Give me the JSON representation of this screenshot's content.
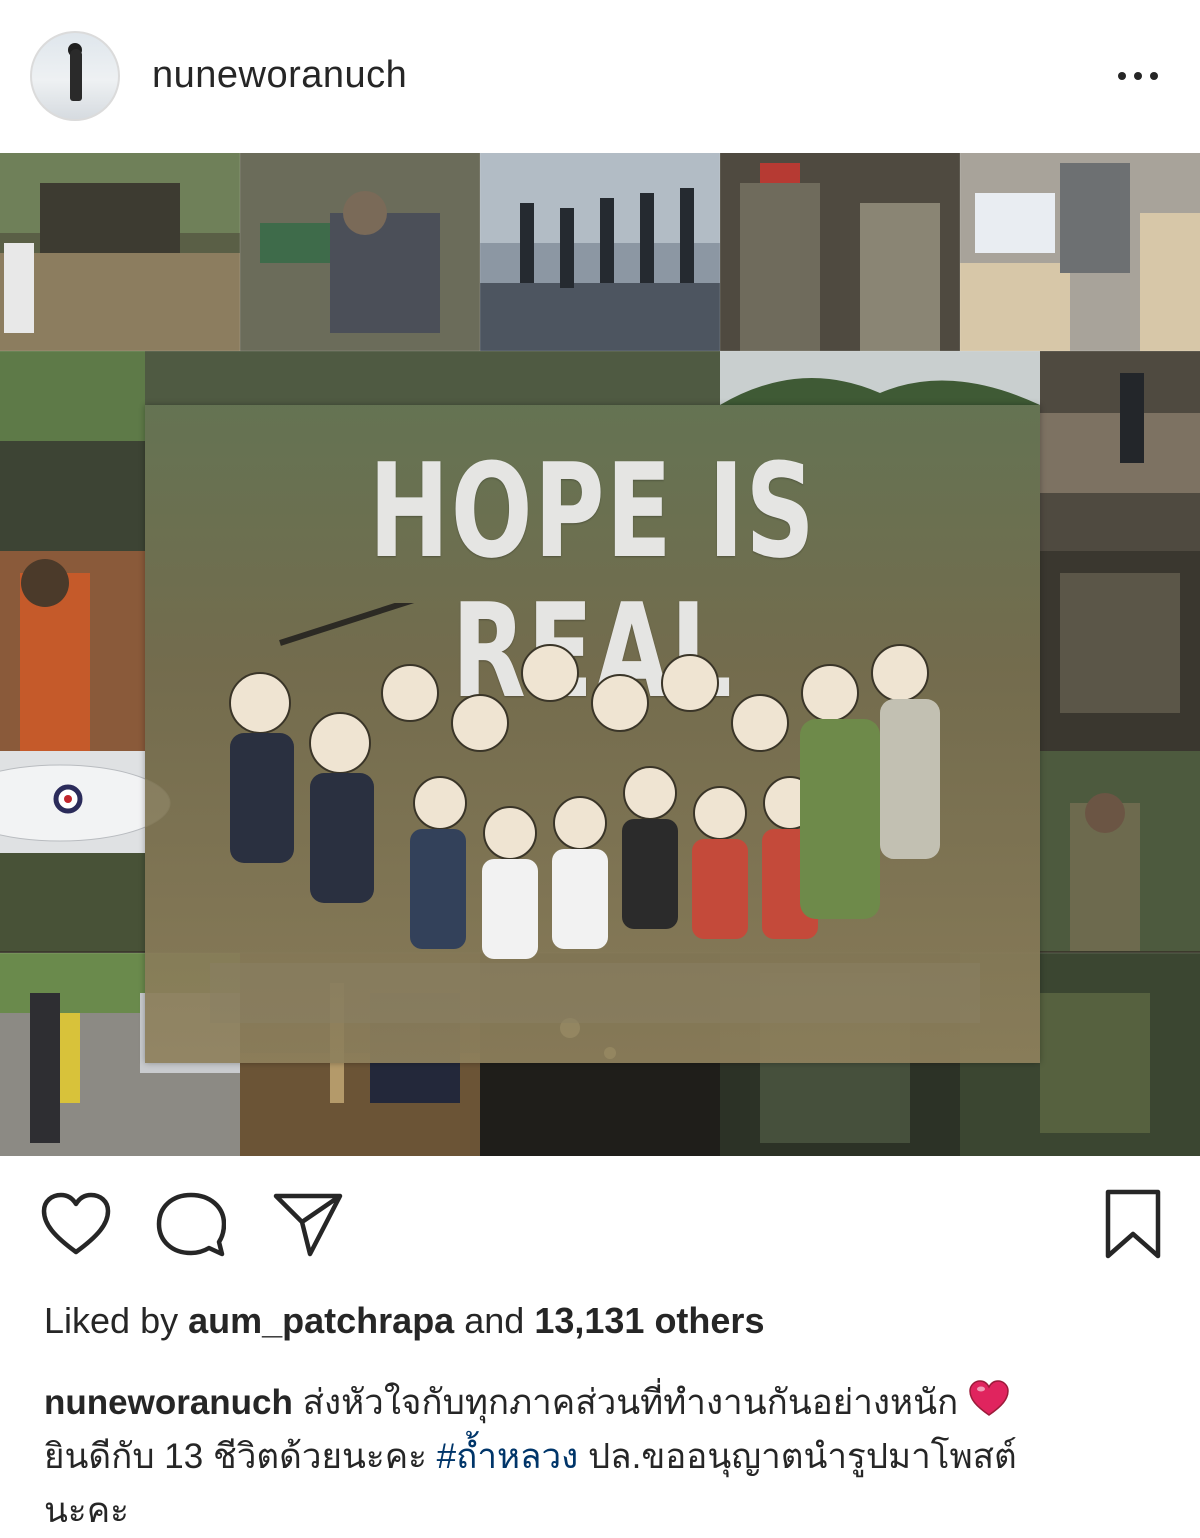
{
  "post": {
    "username": "nuneworanuch",
    "more_icon": "more-horizontal-icon",
    "image": {
      "overlay_text": "HOPE IS REAL"
    },
    "actions": {
      "like_icon": "heart-outline-icon",
      "comment_icon": "comment-icon",
      "share_icon": "share-paper-plane-icon",
      "save_icon": "bookmark-icon"
    },
    "likes": {
      "prefix": "Liked by",
      "user": "aum_patchrapa",
      "middle": "and",
      "count_text": "13,131 others"
    },
    "caption": {
      "user": "nuneworanuch",
      "text_1": "ส่งหัวใจกับทุกภาคส่วนที่ทำงานกันอย่างหนัก",
      "emoji": "red-heart-emoji",
      "text_2": "ยินดีกับ 13 ชีวิตด้วยนะคะ",
      "hashtag": "#ถ้ำหลวง",
      "text_3": "ปล.ขออนุญาตนำรูปมาโพสต์",
      "text_4": "นะคะ"
    }
  },
  "colors": {
    "text": "#262626",
    "hashtag": "#003569",
    "heart_emoji": "#e0245e",
    "background": "#ffffff"
  }
}
